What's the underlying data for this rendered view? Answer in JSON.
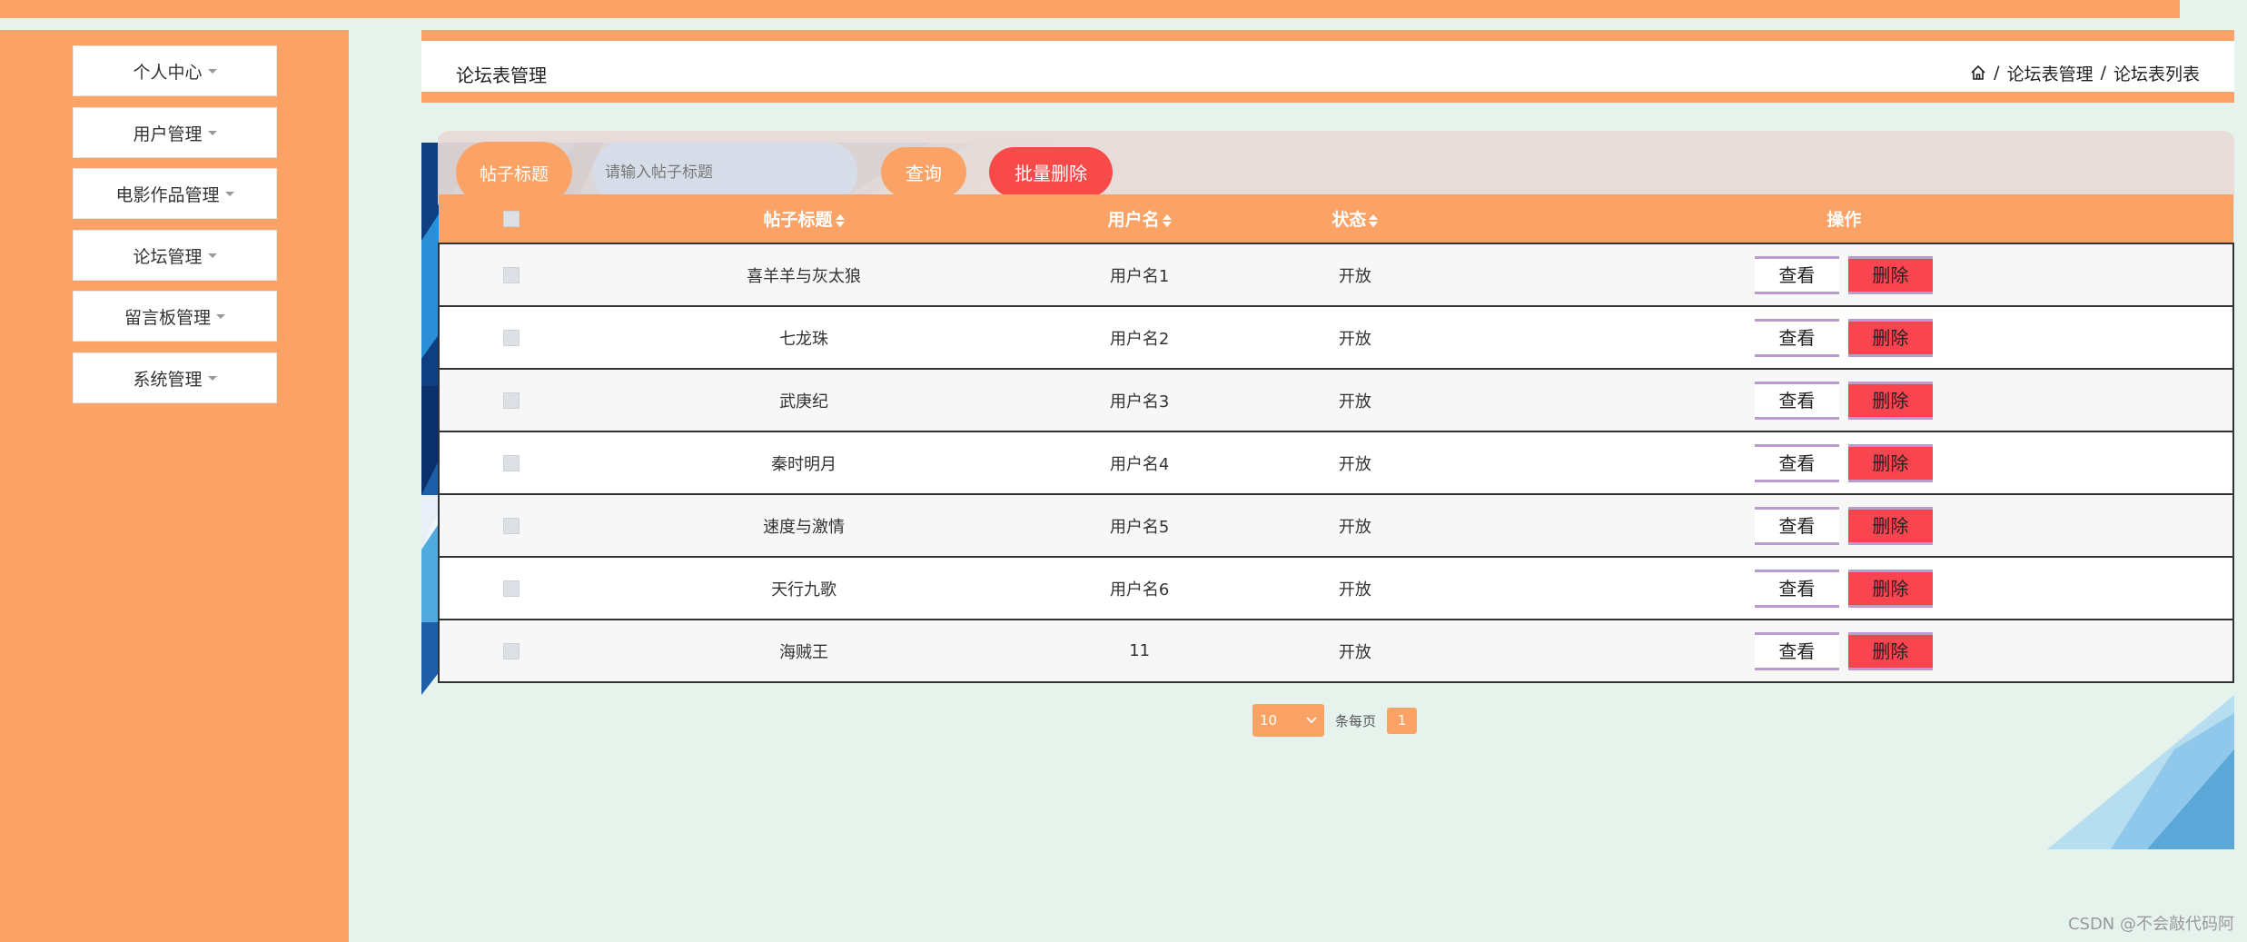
{
  "sidebar": {
    "items": [
      {
        "label": "个人中心"
      },
      {
        "label": "用户管理"
      },
      {
        "label": "电影作品管理"
      },
      {
        "label": "论坛管理"
      },
      {
        "label": "留言板管理"
      },
      {
        "label": "系统管理"
      }
    ]
  },
  "header": {
    "title": "论坛表管理",
    "breadcrumb": [
      "论坛表管理",
      "论坛表列表"
    ],
    "separator": "/"
  },
  "search": {
    "label": "帖子标题",
    "placeholder": "请输入帖子标题",
    "query_label": "查询",
    "batch_delete_label": "批量删除"
  },
  "table": {
    "columns": [
      "帖子标题",
      "用户名",
      "状态",
      "操作"
    ],
    "view_label": "查看",
    "delete_label": "删除",
    "rows": [
      {
        "title": "喜羊羊与灰太狼",
        "username": "用户名1",
        "status": "开放"
      },
      {
        "title": "七龙珠",
        "username": "用户名2",
        "status": "开放"
      },
      {
        "title": "武庚纪",
        "username": "用户名3",
        "status": "开放"
      },
      {
        "title": "秦时明月",
        "username": "用户名4",
        "status": "开放"
      },
      {
        "title": "速度与激情",
        "username": "用户名5",
        "status": "开放"
      },
      {
        "title": "天行九歌",
        "username": "用户名6",
        "status": "开放"
      },
      {
        "title": "海贼王",
        "username": "11",
        "status": "开放"
      }
    ]
  },
  "pagination": {
    "page_size": "10",
    "per_page_label": "条每页",
    "current_page": "1"
  },
  "watermark": "CSDN @不会敲代码阿",
  "colors": {
    "accent": "#fba366",
    "danger": "#f94a4a",
    "background": "#e6f2ec"
  }
}
